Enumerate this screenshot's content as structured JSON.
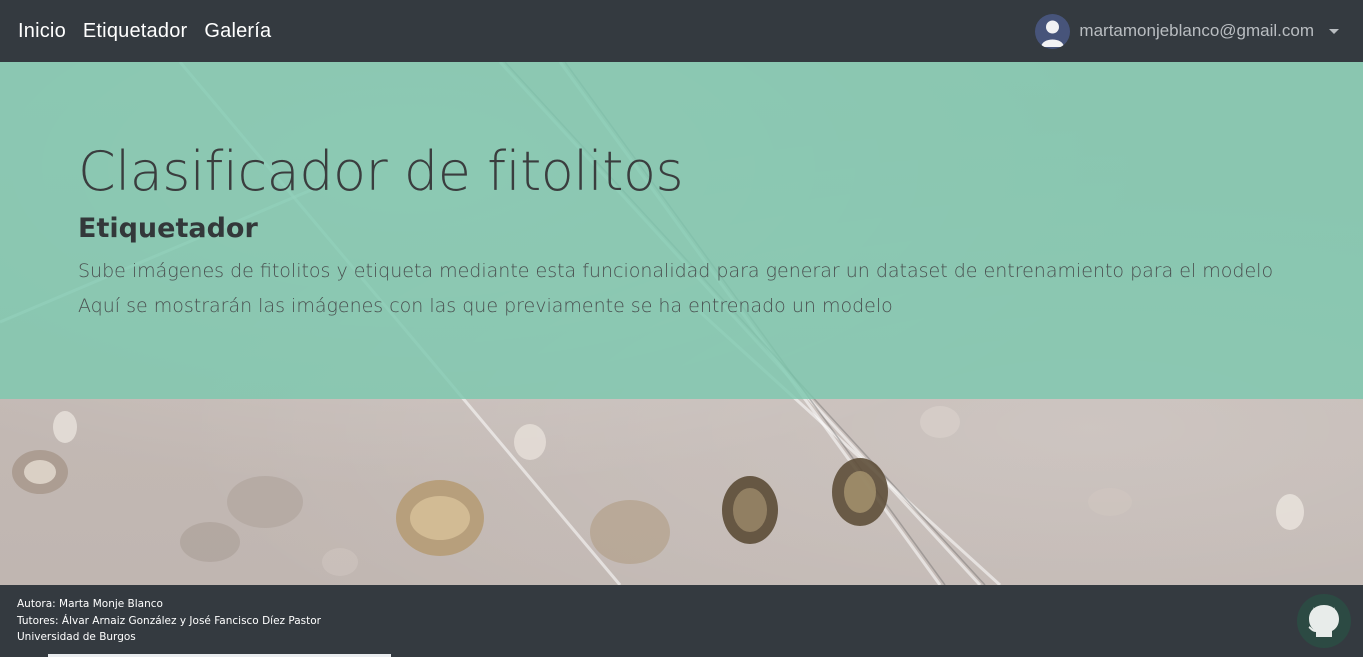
{
  "navbar": {
    "links": [
      {
        "label": "Inicio"
      },
      {
        "label": "Etiquetador"
      },
      {
        "label": "Galería"
      }
    ],
    "user": {
      "email": "martamonjeblanco@gmail.com",
      "avatar_icon": "user-avatar-icon",
      "dropdown_icon": "caret-down-icon"
    }
  },
  "hero": {
    "title": "Clasificador de fitolitos",
    "subtitle": "Etiquetador",
    "lines": [
      "Sube imágenes de fitolitos y etiqueta mediante esta funcionalidad para generar un dataset de entrenamiento para el modelo",
      "Aquí se mostrarán las imágenes con las que previamente se ha entrenado un modelo"
    ]
  },
  "footer": {
    "author": "Autora: Marta Monje Blanco",
    "tutors": "Tutores: Álvar Arnaiz González y José Fancisco Díez Pastor",
    "university": "Universidad de Burgos",
    "github_icon": "github-icon"
  },
  "colors": {
    "navbar_bg": "#343a40",
    "hero_overlay": "#7dc8af",
    "title_text": "#3a3d3e"
  }
}
